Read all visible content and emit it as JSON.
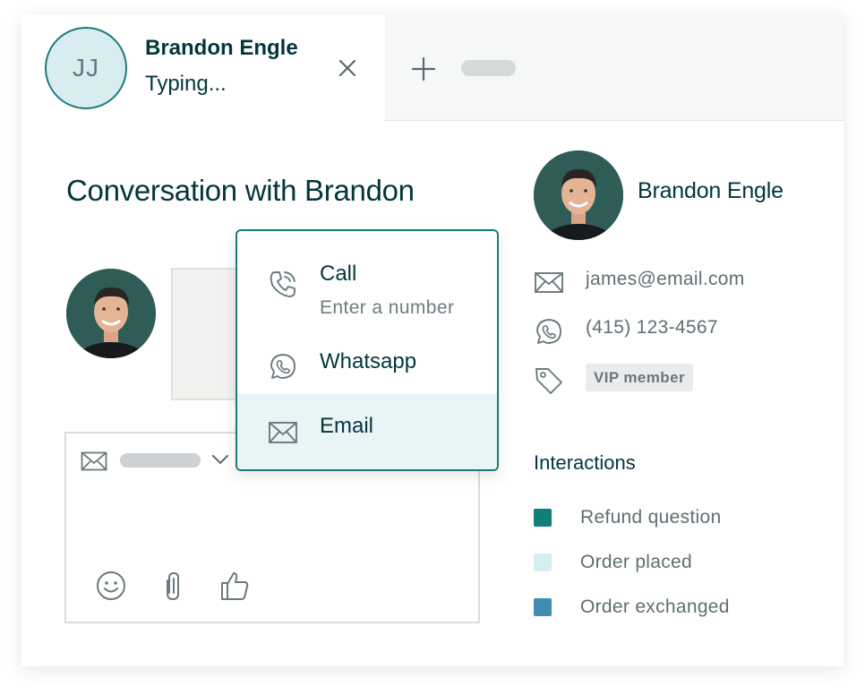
{
  "tab": {
    "initials": "JJ",
    "name": "Brandon Engle",
    "status": "Typing..."
  },
  "conversation": {
    "title": "Conversation with Brandon"
  },
  "channel_menu": {
    "items": [
      {
        "label": "Call",
        "sublabel": "Enter a number",
        "icon": "phone-icon"
      },
      {
        "label": "Whatsapp",
        "icon": "whatsapp-icon"
      },
      {
        "label": "Email",
        "icon": "mail-icon",
        "selected": true
      }
    ]
  },
  "profile": {
    "name": "Brandon Engle",
    "email": "james@email.com",
    "phone": "(415) 123-4567",
    "tag": "VIP member"
  },
  "interactions": {
    "heading": "Interactions",
    "items": [
      {
        "label": "Refund question",
        "color": "#117e78"
      },
      {
        "label": "Order placed",
        "color": "#d5eef2"
      },
      {
        "label": "Order exchanged",
        "color": "#3f8db3"
      }
    ]
  },
  "colors": {
    "brand": "#03363d",
    "accent": "#1a7b7a",
    "selected_bg": "#e9f4f6"
  }
}
